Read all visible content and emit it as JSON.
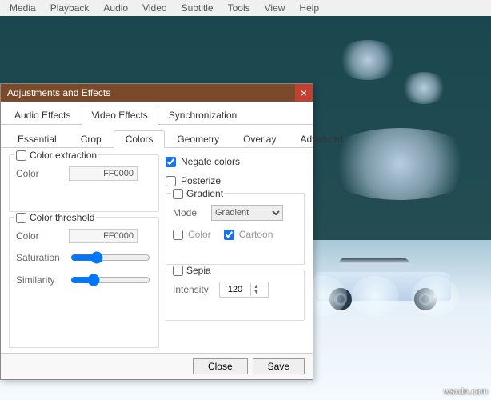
{
  "menubar": [
    "Media",
    "Playback",
    "Audio",
    "Video",
    "Subtitle",
    "Tools",
    "View",
    "Help"
  ],
  "dialog": {
    "title": "Adjustments and Effects",
    "close_glyph": "×",
    "tabs": [
      "Audio Effects",
      "Video Effects",
      "Synchronization"
    ],
    "active_tab": 1,
    "subtabs": [
      "Essential",
      "Crop",
      "Colors",
      "Geometry",
      "Overlay",
      "Advanced"
    ],
    "active_subtab": 2,
    "color_extraction": {
      "label": "Color extraction",
      "checked": false,
      "color_label": "Color",
      "color_value": "FF0000"
    },
    "color_threshold": {
      "label": "Color threshold",
      "checked": false,
      "color_label": "Color",
      "color_value": "FF0000",
      "saturation_label": "Saturation",
      "similarity_label": "Similarity"
    },
    "negate": {
      "label": "Negate colors",
      "checked": true
    },
    "posterize": {
      "label": "Posterize",
      "checked": false
    },
    "gradient": {
      "label": "Gradient",
      "checked": false,
      "mode_label": "Mode",
      "mode_value": "Gradient",
      "color_label": "Color",
      "color_checked": false,
      "cartoon_label": "Cartoon",
      "cartoon_checked": true
    },
    "sepia": {
      "label": "Sepia",
      "checked": false,
      "intensity_label": "Intensity",
      "intensity_value": "120"
    },
    "buttons": {
      "close": "Close",
      "save": "Save"
    }
  },
  "watermark": "wsxdn.com"
}
